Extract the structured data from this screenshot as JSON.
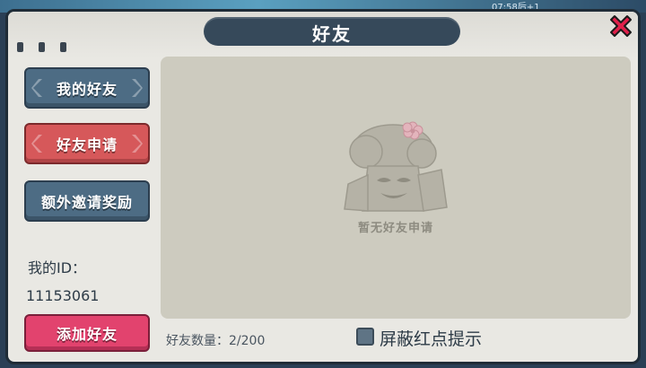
{
  "background": {
    "time_text": "07:58后+1"
  },
  "window": {
    "title": "好友"
  },
  "sidebar": {
    "buttons": [
      {
        "label": "我的好友",
        "state": "normal"
      },
      {
        "label": "好友申请",
        "state": "selected"
      },
      {
        "label": "额外邀请奖励",
        "state": "normal"
      }
    ],
    "id_label": "我的ID：",
    "id_value": "11153061",
    "add_friend_label": "添加好友"
  },
  "content": {
    "empty_message": "暂无好友申请",
    "empty_icon": "sleeping-tree-monster-illustration"
  },
  "footer": {
    "friend_count": "好友数量：2/200",
    "block_redpoint_label": "屏蔽红点提示",
    "block_redpoint_checked": false
  },
  "colors": {
    "title_bar": "#36495a",
    "tab_normal": "#4d6c84",
    "tab_selected": "#d6585a",
    "add_button": "#e2436e",
    "close_icon": "#e0204a"
  }
}
